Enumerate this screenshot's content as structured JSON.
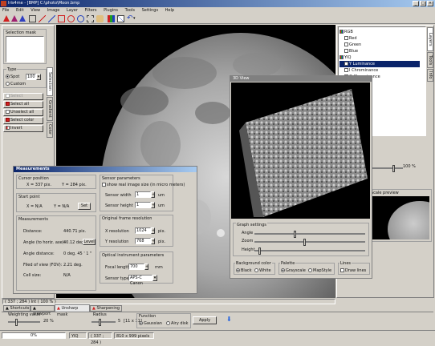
{
  "titlebar": {
    "title": "Iris4me - [BMP] C:\\photo\\Moon.bmp"
  },
  "menu": [
    "File",
    "Edit",
    "View",
    "Image",
    "Layer",
    "Filters",
    "Plugins",
    "Tools",
    "Settings",
    "Help"
  ],
  "toolbar": {
    "undo_label": "undo"
  },
  "left_panel": {
    "selection_mask": "Selection mask",
    "type_label": "Type",
    "spot_label": "Spot",
    "spot_value": "100",
    "custom_label": "Custom",
    "select_label": "Select",
    "select_all": "Select all",
    "unselect_all": "Unselect all",
    "select_color": "Select color",
    "invert": "Invert",
    "tabs": [
      "Selection",
      "Gradient",
      "Color"
    ]
  },
  "layers": {
    "items": [
      "RGB",
      "Red",
      "Green",
      "Blue",
      "YIQ",
      "Y Luminance",
      "I Chrominance",
      "Q Chrominance"
    ],
    "selected": "Y Luminance",
    "tabs": [
      "Layers",
      "Tools",
      "Info"
    ]
  },
  "zoom": {
    "value": "100 %"
  },
  "scale_preview": {
    "title": "Scale preview"
  },
  "measurements": {
    "title": "Measurements",
    "cursor_position": "Cursor position",
    "cursor_x": "X = 337 pix.",
    "cursor_y": "Y = 284 pix.",
    "start_point": "Start point",
    "start_x": "X = N/A",
    "start_y": "Y = N/A",
    "set_button": "Set",
    "measurements_label": "Measurements",
    "rows": [
      {
        "label": "Distance:",
        "value": "440.71 pix."
      },
      {
        "label": "Angle (to horiz. axe):",
        "value": "40.12 deg."
      },
      {
        "label": "Angle distance:",
        "value": "0 deg. 45 ' 1 \""
      },
      {
        "label": "Filed of view (FOV):",
        "value": "2.21 deg."
      },
      {
        "label": "Cell size:",
        "value": "N/A"
      }
    ],
    "level_button": "Level",
    "sensor_params": "Sensor parameters",
    "show_real_size": "show real image size (in micro meters)",
    "sensor_width_label": "Sensor width",
    "sensor_width": "1",
    "sensor_height_label": "Sensor height",
    "sensor_height": "1",
    "um": "um",
    "orig_res": "Original frame resolution",
    "x_res_label": "X resolution",
    "x_res": "1024",
    "y_res_label": "Y resolution",
    "y_res": "768",
    "pix": "pix.",
    "optical": "Optical instrument parameters",
    "focal_label": "Focal length",
    "focal": "700",
    "mm": "mm",
    "sensor_type_label": "Sensor type:",
    "sensor_type": "APS-C Canon"
  },
  "view3d": {
    "title": "3D View",
    "graph_settings": "Graph settings",
    "angle": "Angle",
    "zoom": "Zoom",
    "height": "Height",
    "bg_color": "Background color",
    "black": "Black",
    "white": "White",
    "palette": "Palette",
    "grayscale": "Grayscale",
    "mapstyle": "MapStyle",
    "lines": "Lines",
    "draw_lines": "Draw lines"
  },
  "status_strip": "( 337 ; 284 ) Int ( 100 % )",
  "bottom_tabs": [
    "Shortcuts",
    "Viewport",
    "Unsharp mask",
    "Sharpening"
  ],
  "unsharp": {
    "weighting": "Weighting value",
    "weighting_value": "20 %",
    "radius": "Radius",
    "radius_value": "5",
    "radius_range": "[11 x 11]",
    "function": "Function",
    "gaussian": "Gaussian",
    "airy": "Airy disk",
    "apply": "Apply"
  },
  "statusbar": {
    "progress": "0%",
    "channel": "YIQ",
    "coords": "( 337 ; 284 )",
    "size": "810 x 999 pixels"
  },
  "colors": {
    "accent": "#0a246a",
    "moon_bg": "#000000"
  }
}
